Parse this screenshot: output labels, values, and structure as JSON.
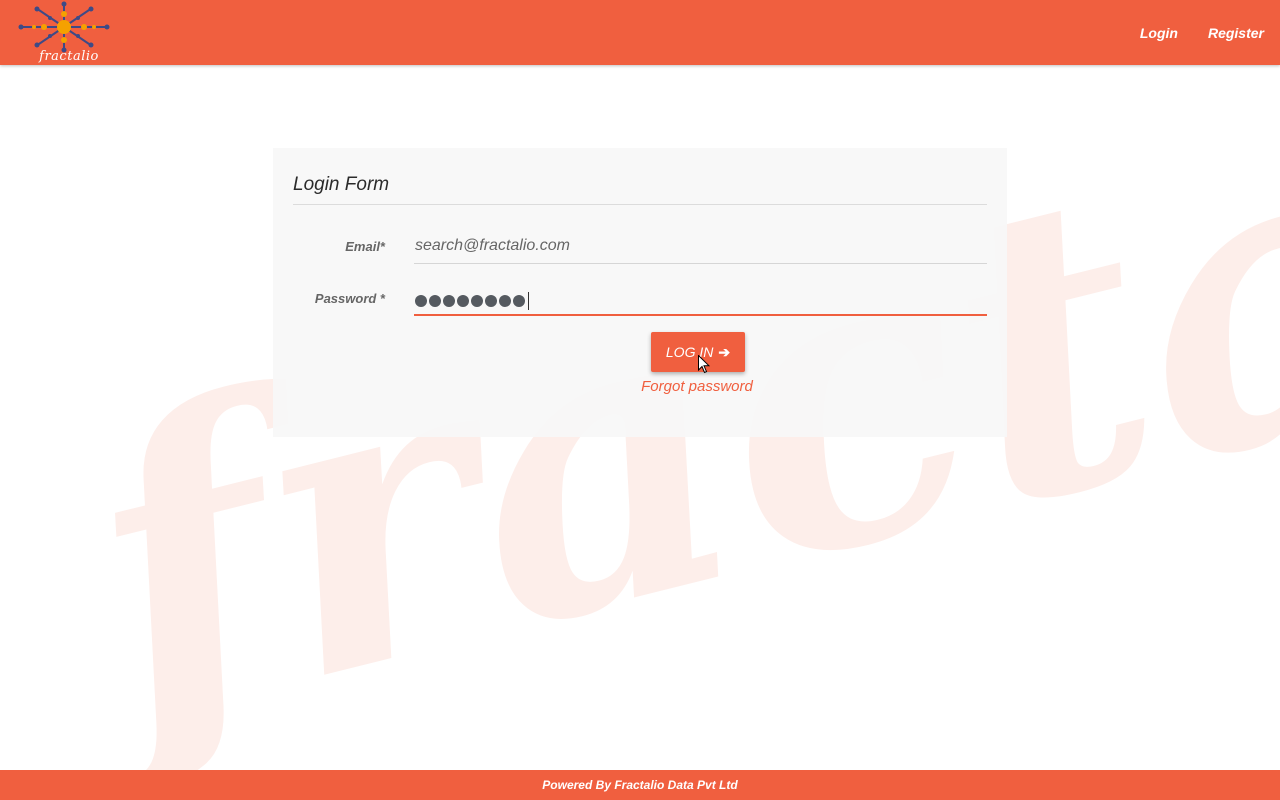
{
  "header": {
    "logo_text": "fractalio",
    "nav": {
      "login": "Login",
      "register": "Register"
    }
  },
  "watermark": "fractalio",
  "login_form": {
    "title": "Login Form",
    "email_label": "Email*",
    "email_value": "search@fractalio.com",
    "password_label": "Password *",
    "password_masked_length": 8,
    "login_button": "LOG IN",
    "login_button_icon": "arrow-right-icon",
    "forgot_link": "Forgot password"
  },
  "footer": {
    "text": "Powered By Fractalio Data Pvt Ltd"
  },
  "colors": {
    "brand": "#f05f3f",
    "watermark": "#fdeeea",
    "card": "#f7f7f7"
  }
}
